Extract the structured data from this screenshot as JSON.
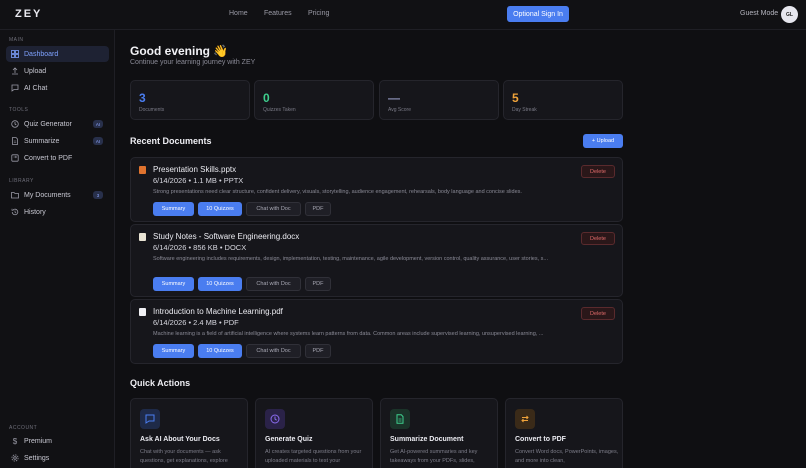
{
  "nav": {
    "logo": "ZEY",
    "links": [
      "Home",
      "Features",
      "Pricing"
    ],
    "signin": "Optional Sign In",
    "guest": "Guest Mode",
    "avatar": "GL"
  },
  "sidebar": {
    "sections": {
      "main": "MAIN",
      "tools": "TOOLS",
      "library": "LIBRARY",
      "account": "ACCOUNT"
    },
    "items": {
      "dashboard": "Dashboard",
      "upload": "Upload",
      "ai_chat": "AI Chat",
      "quiz_generator": "Quiz Generator",
      "quiz_badge": "AI",
      "summarize": "Summarize",
      "summarize_badge": "AI",
      "convert": "Convert to PDF",
      "my_documents": "My Documents",
      "docs_badge": "3",
      "history": "History",
      "premium": "Premium",
      "settings": "Settings"
    }
  },
  "header": {
    "greeting": "Good evening 👋",
    "subtitle": "Continue your learning journey with ZEY"
  },
  "stats": [
    {
      "value": "3",
      "label": "Documents",
      "color": "#4a7df0"
    },
    {
      "value": "0",
      "label": "Quizzes Taken",
      "color": "#3ecf8e"
    },
    {
      "value": "—",
      "label": "Avg Score",
      "color": "#8a8fb5"
    },
    {
      "value": "5",
      "label": "Day Streak",
      "color": "#f0a33a"
    }
  ],
  "recent": {
    "title": "Recent Documents",
    "upload_btn": "+ Upload"
  },
  "documents": [
    {
      "name": "Presentation Skills.pptx",
      "meta": "6/14/2026 • 1.1 MB • PPTX",
      "desc": "Strong presentations need clear structure, confident delivery, visuals, storytelling, audience engagement, rehearsals, body language and concise slides.",
      "delete": "Delete",
      "actions": [
        "Summary",
        "10 Quizzes",
        "Chat with Doc",
        "PDF"
      ]
    },
    {
      "name": "Study Notes - Software Engineering.docx",
      "meta": "6/14/2026 • 856 KB • DOCX",
      "desc": "Software engineering includes requirements, design, implementation, testing, maintenance, agile development, version control, quality assurance, user stories, s...",
      "delete": "Delete",
      "actions": [
        "Summary",
        "10 Quizzes",
        "Chat with Doc",
        "PDF"
      ]
    },
    {
      "name": "Introduction to Machine Learning.pdf",
      "meta": "6/14/2026 • 2.4 MB • PDF",
      "desc": "Machine learning is a field of artificial intelligence where systems learn patterns from data. Common areas include supervised learning, unsupervised learning, ...",
      "delete": "Delete",
      "actions": [
        "Summary",
        "10 Quizzes",
        "Chat with Doc",
        "PDF"
      ]
    }
  ],
  "quick_actions": {
    "title": "Quick Actions",
    "cards": [
      {
        "title": "Ask AI About Your Docs",
        "desc": "Chat with your documents — ask questions, get explanations, explore",
        "icon": "chat-icon",
        "color": "#4a7df0"
      },
      {
        "title": "Generate Quiz",
        "desc": "AI creates targeted questions from your uploaded materials to test your",
        "icon": "clock-icon",
        "color": "#8b6cf0"
      },
      {
        "title": "Summarize Document",
        "desc": "Get AI-powered summaries and key takeaways from your PDFs, slides,",
        "icon": "document-icon",
        "color": "#3ecf8e"
      },
      {
        "title": "Convert to PDF",
        "desc": "Convert Word docs, PowerPoints, images, and more into clean,",
        "icon": "convert-icon",
        "color": "#f0a33a"
      }
    ]
  }
}
